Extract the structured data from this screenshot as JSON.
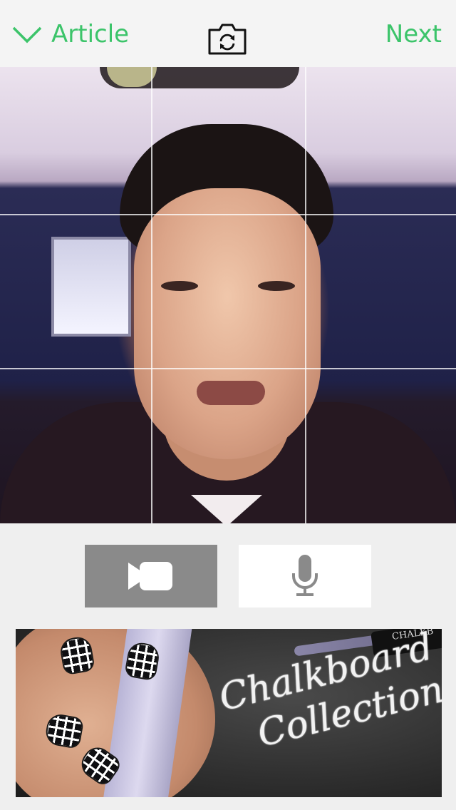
{
  "header": {
    "back_label": "Article",
    "next_label": "Next"
  },
  "capture_modes": {
    "items": [
      {
        "name": "video",
        "icon": "video-camera-icon",
        "selected": true
      },
      {
        "name": "audio",
        "icon": "microphone-icon",
        "selected": false
      }
    ]
  },
  "ad": {
    "brand": "CHALKB",
    "title_line1": "Chalkboard",
    "title_line2": "Collection"
  },
  "colors": {
    "accent": "#3cc46a",
    "selected_mode_bg": "#8a8a8a",
    "unselected_mode_bg": "#ffffff",
    "background": "#efefef"
  }
}
